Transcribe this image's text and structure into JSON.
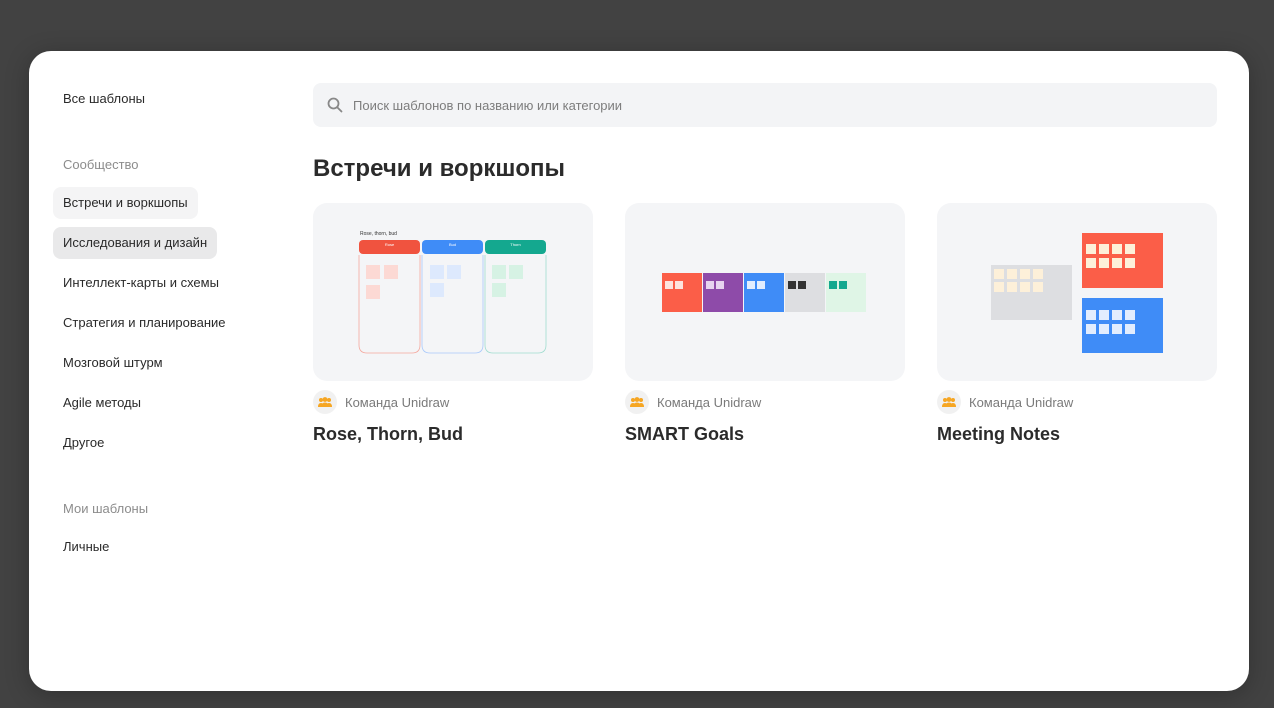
{
  "sidebar": {
    "all_templates": "Все шаблоны",
    "community_heading": "Сообщество",
    "items": [
      {
        "label": "Встречи и воркшопы"
      },
      {
        "label": "Исследования и дизайн"
      },
      {
        "label": "Интеллект-карты и схемы"
      },
      {
        "label": "Стратегия и планирование"
      },
      {
        "label": "Мозговой штурм"
      },
      {
        "label": "Agile методы"
      },
      {
        "label": "Другое"
      }
    ],
    "my_templates_heading": "Мои шаблоны",
    "personal": "Личные"
  },
  "search": {
    "placeholder": "Поиск шаблонов по названию или категории",
    "icon": "search-icon"
  },
  "section": {
    "title": "Встречи и воркшопы"
  },
  "cards": [
    {
      "title": "Rose, Thorn, Bud",
      "author": "Команда Unidraw",
      "thumb_heading": "Rose, thorn, bud",
      "columns": [
        {
          "label": "Rose",
          "color": "#f0533f"
        },
        {
          "label": "Bud",
          "color": "#3f8cf7"
        },
        {
          "label": "Thorn",
          "color": "#14a88f"
        }
      ]
    },
    {
      "title": "SMART Goals",
      "author": "Команда Unidraw"
    },
    {
      "title": "Meeting Notes",
      "author": "Команда Unidraw"
    }
  ],
  "colors": {
    "red": "#fb5e48",
    "purple": "#8e4ba9",
    "blue": "#3f8cf7",
    "gray": "#dddee1",
    "mint": "#dff5e6",
    "teal": "#14a88f",
    "avatar_orange": "#f6a623"
  }
}
